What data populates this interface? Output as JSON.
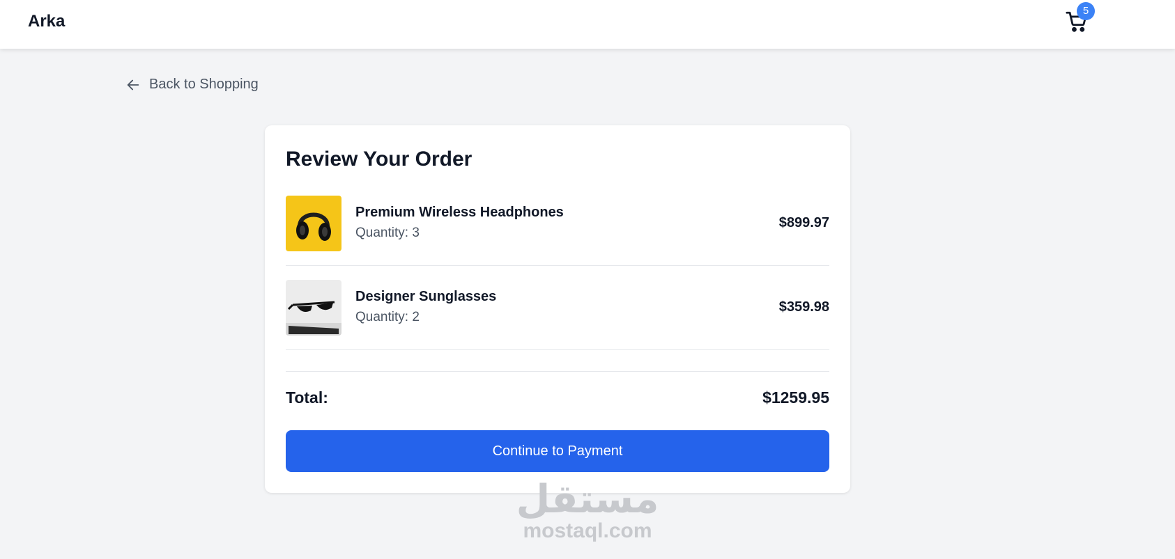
{
  "header": {
    "brand": "Arka",
    "cart_count": "5"
  },
  "nav": {
    "back_label": "Back to Shopping"
  },
  "order": {
    "title": "Review Your Order",
    "qty_prefix": "Quantity: ",
    "items": [
      {
        "name": "Premium Wireless Headphones",
        "quantity": "3",
        "price": "$899.97",
        "thumb_icon": "headphones-image"
      },
      {
        "name": "Designer Sunglasses",
        "quantity": "2",
        "price": "$359.98",
        "thumb_icon": "sunglasses-image"
      }
    ],
    "total_label": "Total:",
    "total_value": "$1259.95",
    "continue_label": "Continue to Payment"
  },
  "watermark": {
    "arabic": "مستقل",
    "latin": "mostaql.com"
  },
  "colors": {
    "accent": "#2563eb",
    "badge": "#3b82f6",
    "page_background": "#f3f4f6"
  }
}
